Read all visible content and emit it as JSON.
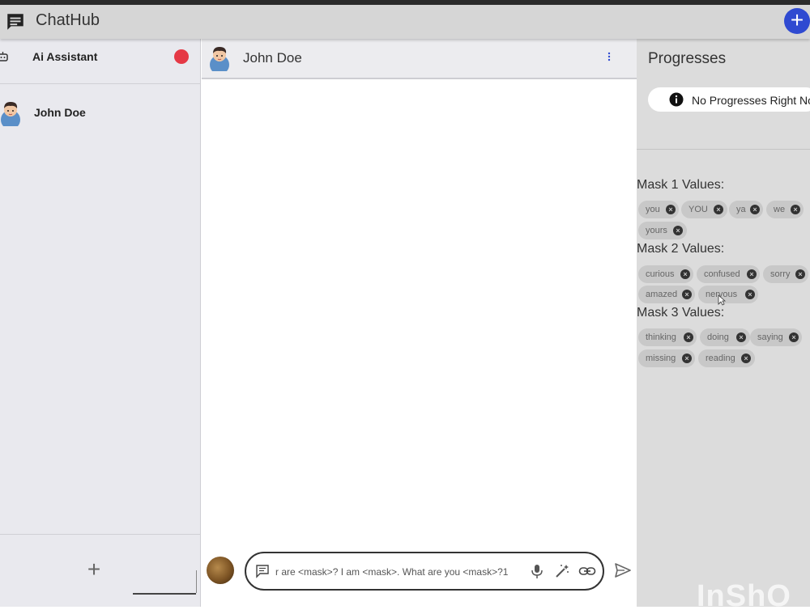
{
  "app": {
    "title": "ChatHub"
  },
  "sidebar": {
    "conversations": [
      {
        "name": "Ai Assistant"
      },
      {
        "name": "John Doe"
      }
    ]
  },
  "chat": {
    "contact_name": "John Doe",
    "composer_text": "r are <mask>? I am <mask>. What are you <mask>?1"
  },
  "progress": {
    "title": "Progresses",
    "empty_message": "No Progresses Right Now",
    "masks": [
      {
        "title": "Mask 1 Values:",
        "values": [
          "you",
          "YOU",
          "ya",
          "we",
          "yours"
        ]
      },
      {
        "title": "Mask 2 Values:",
        "values": [
          "curious",
          "confused",
          "sorry",
          "amazed",
          "nervous"
        ]
      },
      {
        "title": "Mask 3 Values:",
        "values": [
          "thinking",
          "doing",
          "saying",
          "missing",
          "reading"
        ]
      }
    ]
  },
  "watermark": "InShO",
  "colors": {
    "accent": "#2f4ad1",
    "status_dot": "#e53945"
  }
}
